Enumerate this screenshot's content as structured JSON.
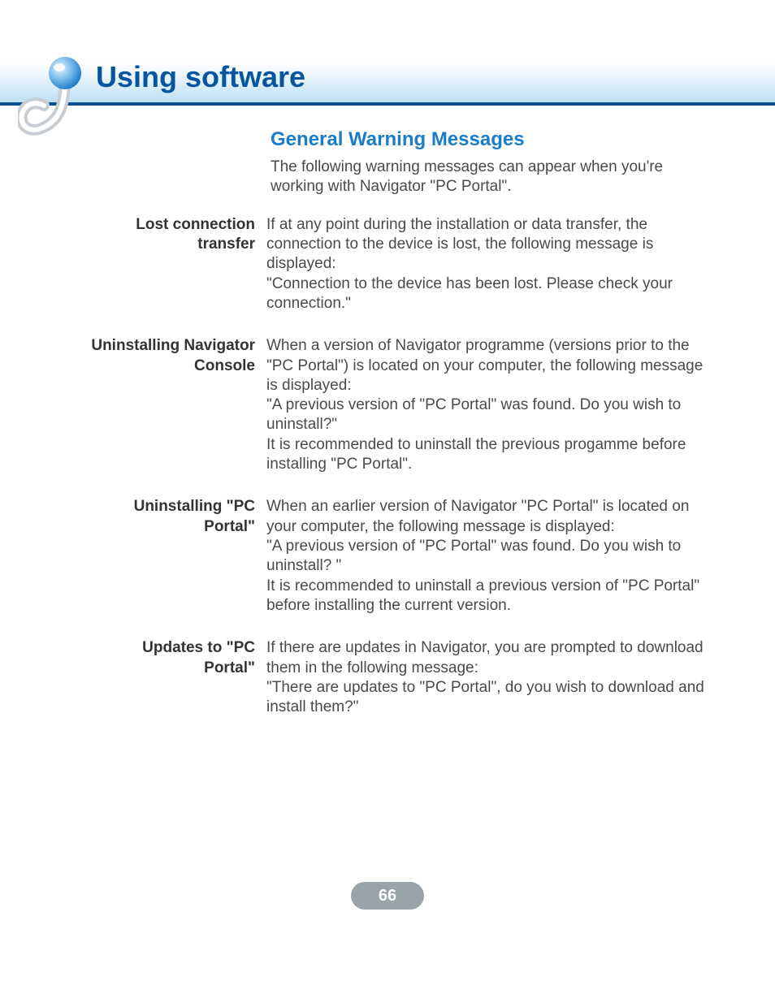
{
  "header": {
    "title": "Using software"
  },
  "section": {
    "heading": "General Warning Messages",
    "intro": "The following warning messages can appear when you're working with Navigator \"PC Portal\"."
  },
  "blocks": [
    {
      "label": "Lost connection transfer",
      "body": "If at any point during the installation or data transfer, the connection to the device is lost, the following message is displayed:\n\"Connection to the device has been lost. Please check your connection.\""
    },
    {
      "label": "Uninstalling Navigator Console",
      "body": "When a version of Navigator programme (versions prior to the \"PC Portal\") is located on your computer, the following message is displayed:\n\"A previous version of \"PC Portal\" was found. Do you wish to uninstall?\"\nIt is recommended to uninstall the previous progamme before installing \"PC Portal\"."
    },
    {
      "label": "Uninstalling \"PC Portal\"",
      "body": "When an earlier version of Navigator \"PC Portal\" is located on your computer, the following message is displayed:\n\"A previous version of \"PC Portal\" was found. Do you wish to uninstall? \"\nIt is recommended to uninstall a previous version of \"PC Portal\" before installing the current version."
    },
    {
      "label": "Updates to \"PC Portal\"",
      "body": "If there are updates in Navigator, you are prompted to download them in the following message:\n\"There are updates to \"PC Portal\", do you wish to download and install them?\""
    }
  ],
  "page_number": "66"
}
